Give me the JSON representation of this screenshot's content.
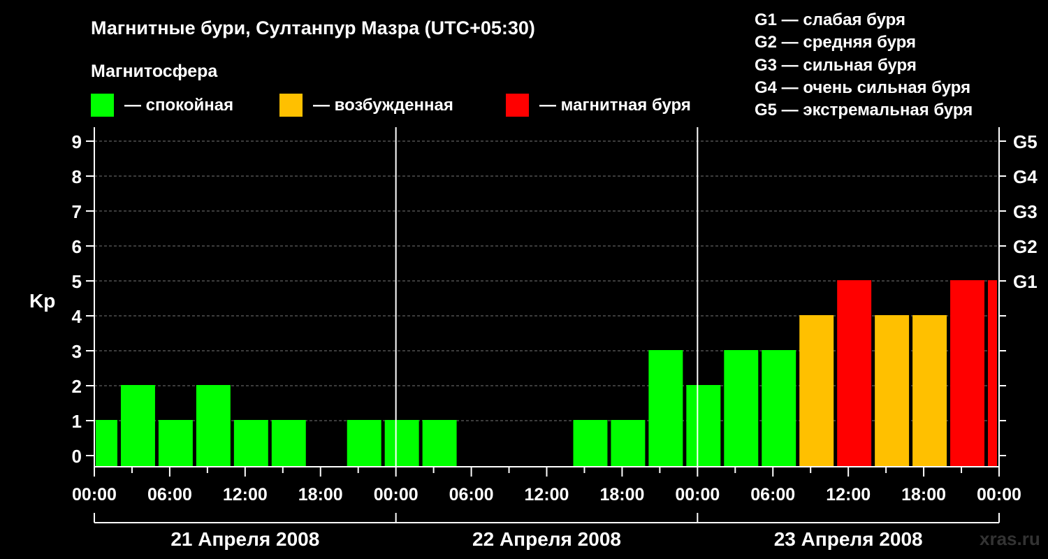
{
  "title": "Магнитные бури, Султанпур Мазра (UTC+05:30)",
  "legend": {
    "heading": "Магнитосфера",
    "items": [
      {
        "color": "#00ff00",
        "label": "— спокойная"
      },
      {
        "color": "#ffc000",
        "label": "— возбужденная"
      },
      {
        "color": "#ff0000",
        "label": "— магнитная буря"
      }
    ]
  },
  "g_scale": [
    "G1 — слабая буря",
    "G2 — средняя буря",
    "G3 — сильная буря",
    "G4 — очень сильная буря",
    "G5 — экстремальная буря"
  ],
  "watermark": "xras.ru",
  "colors": {
    "quiet": "#00ff00",
    "active": "#ffc000",
    "storm": "#ff0000",
    "background": "#000000"
  },
  "chart_data": {
    "type": "bar",
    "ylabel": "Kp",
    "ylim": [
      0,
      9
    ],
    "yticks": [
      "0",
      "1",
      "2",
      "3",
      "4",
      "5",
      "6",
      "7",
      "8",
      "9"
    ],
    "right_ticks": [
      {
        "value": 5,
        "label": "G1"
      },
      {
        "value": 6,
        "label": "G2"
      },
      {
        "value": 7,
        "label": "G3"
      },
      {
        "value": 8,
        "label": "G4"
      },
      {
        "value": 9,
        "label": "G5"
      }
    ],
    "xlim": [
      0,
      72
    ],
    "xtick_labels": [
      "00:00",
      "06:00",
      "12:00",
      "18:00",
      "00:00",
      "06:00",
      "12:00",
      "18:00",
      "00:00",
      "06:00",
      "12:00",
      "18:00",
      "00:00"
    ],
    "day_labels": [
      "21 Апреля 2008",
      "22 Апреля 2008",
      "23 Апреля 2008"
    ],
    "grid": true,
    "bars": [
      {
        "start": 0,
        "end": 2,
        "kp": 1
      },
      {
        "start": 2,
        "end": 5,
        "kp": 2
      },
      {
        "start": 5,
        "end": 8,
        "kp": 1
      },
      {
        "start": 8,
        "end": 11,
        "kp": 2
      },
      {
        "start": 11,
        "end": 14,
        "kp": 1
      },
      {
        "start": 14,
        "end": 17,
        "kp": 1
      },
      {
        "start": 17,
        "end": 20,
        "kp": 0
      },
      {
        "start": 20,
        "end": 23,
        "kp": 1
      },
      {
        "start": 23,
        "end": 26,
        "kp": 1
      },
      {
        "start": 26,
        "end": 29,
        "kp": 1
      },
      {
        "start": 29,
        "end": 32,
        "kp": 0
      },
      {
        "start": 32,
        "end": 35,
        "kp": 0
      },
      {
        "start": 35,
        "end": 38,
        "kp": 0
      },
      {
        "start": 38,
        "end": 41,
        "kp": 1
      },
      {
        "start": 41,
        "end": 44,
        "kp": 1
      },
      {
        "start": 44,
        "end": 47,
        "kp": 3
      },
      {
        "start": 47,
        "end": 50,
        "kp": 2
      },
      {
        "start": 50,
        "end": 53,
        "kp": 3
      },
      {
        "start": 53,
        "end": 56,
        "kp": 3
      },
      {
        "start": 56,
        "end": 59,
        "kp": 4
      },
      {
        "start": 59,
        "end": 62,
        "kp": 5
      },
      {
        "start": 62,
        "end": 65,
        "kp": 4
      },
      {
        "start": 65,
        "end": 68,
        "kp": 4
      },
      {
        "start": 68,
        "end": 71,
        "kp": 5
      },
      {
        "start": 71,
        "end": 72,
        "kp": 5
      }
    ]
  }
}
